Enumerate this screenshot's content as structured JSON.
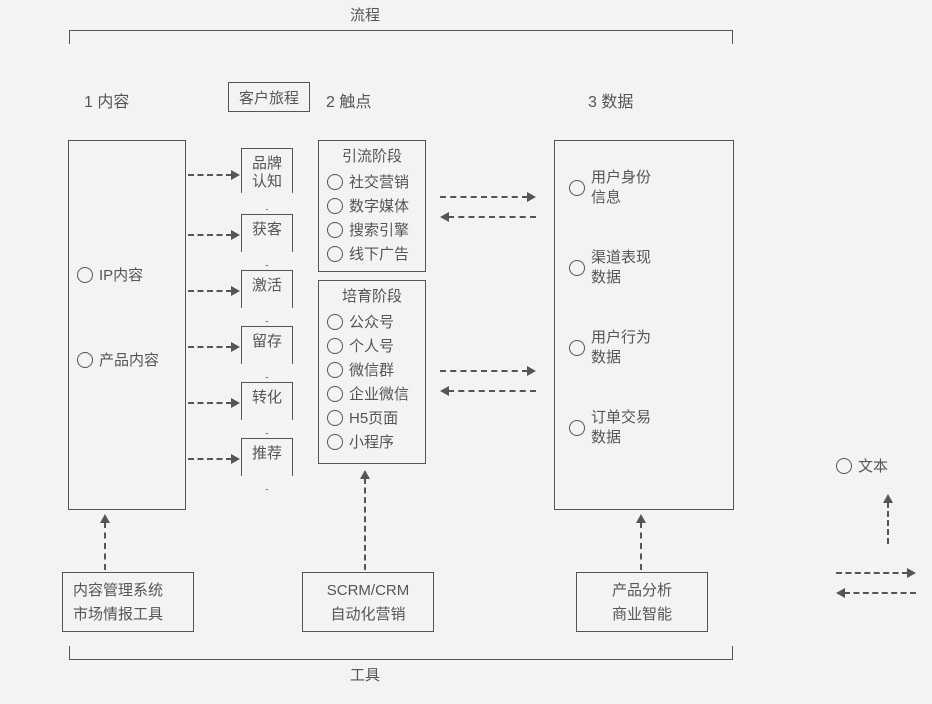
{
  "top_label": "流程",
  "bottom_label": "工具",
  "journey_box": "客户旅程",
  "sections": {
    "s1": "1 内容",
    "s2": "2 触点",
    "s3": "3 数据"
  },
  "content_box": {
    "items": [
      "IP内容",
      "产品内容"
    ]
  },
  "steps": [
    "品牌认知",
    "获客",
    "激活",
    "留存",
    "转化",
    "推荐"
  ],
  "phase1": {
    "title": "引流阶段",
    "items": [
      "社交营销",
      "数字媒体",
      "搜索引擎",
      "线下广告"
    ]
  },
  "phase2": {
    "title": "培育阶段",
    "items": [
      "公众号",
      "个人号",
      "微信群",
      "企业微信",
      "H5页面",
      "小程序"
    ]
  },
  "data_box": {
    "items": [
      "用户身份信息",
      "渠道表现数据",
      "用户行为数据",
      "订单交易数据"
    ]
  },
  "tools": {
    "t1a": "内容管理系统",
    "t1b": "市场情报工具",
    "t2a": "SCRM/CRM",
    "t2b": "自动化营销",
    "t3a": "产品分析",
    "t3b": "商业智能"
  },
  "legend": {
    "text_label": "文本"
  }
}
